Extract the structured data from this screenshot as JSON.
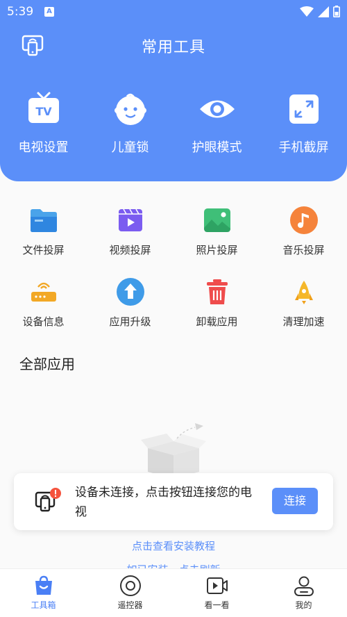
{
  "status_bar": {
    "time": "5:39",
    "notification_icon": "A"
  },
  "header": {
    "title": "常用工具"
  },
  "top_tools": [
    {
      "label": "电视设置",
      "icon": "tv-icon"
    },
    {
      "label": "儿童锁",
      "icon": "child-face-icon"
    },
    {
      "label": "护眼模式",
      "icon": "eye-icon"
    },
    {
      "label": "手机截屏",
      "icon": "screenshot-icon"
    }
  ],
  "grid_tools": [
    {
      "label": "文件投屏",
      "icon": "folder-icon"
    },
    {
      "label": "视频投屏",
      "icon": "video-icon"
    },
    {
      "label": "照片投屏",
      "icon": "photo-icon"
    },
    {
      "label": "音乐投屏",
      "icon": "music-icon"
    },
    {
      "label": "设备信息",
      "icon": "router-icon"
    },
    {
      "label": "应用升级",
      "icon": "upgrade-icon"
    },
    {
      "label": "卸载应用",
      "icon": "trash-icon"
    },
    {
      "label": "清理加速",
      "icon": "rocket-icon"
    }
  ],
  "section": {
    "title": "全部应用"
  },
  "banner": {
    "message": "设备未连接，点击按钮连接您的电视",
    "button": "连接"
  },
  "links": {
    "tutorial": "点击查看安装教程",
    "cut_off": "如已安装，点击刷新"
  },
  "tabs": [
    {
      "label": "工具箱",
      "icon": "toolbox-bag-icon",
      "active": true
    },
    {
      "label": "遥控器",
      "icon": "remote-icon",
      "active": false
    },
    {
      "label": "看一看",
      "icon": "video-play-icon",
      "active": false
    },
    {
      "label": "我的",
      "icon": "user-icon",
      "active": false
    }
  ],
  "colors": {
    "accent": "#5b8ff9",
    "background": "#fafafa",
    "badge": "#f5533d"
  }
}
